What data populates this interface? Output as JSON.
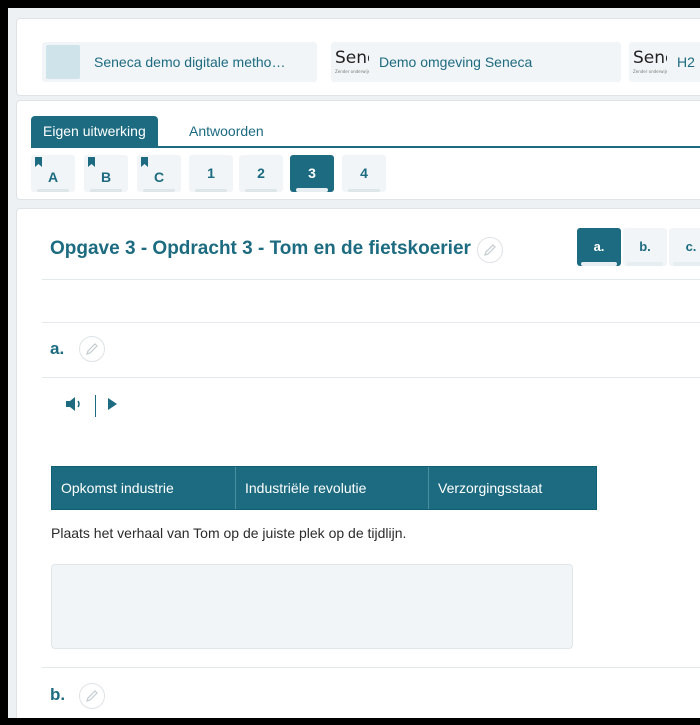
{
  "breadcrumbs": [
    {
      "label": "Seneca demo digitale metho…",
      "thumb": "plain"
    },
    {
      "label": "Demo omgeving Seneca",
      "thumb": "logo",
      "logo_text": "Sene"
    },
    {
      "label": "H2",
      "thumb": "logo",
      "logo_text": "Sene"
    }
  ],
  "mode_tabs": [
    {
      "label": "Eigen uitwerking",
      "active": true
    },
    {
      "label": "Antwoorden",
      "active": false
    }
  ],
  "question_tabs": [
    {
      "label": "A",
      "bookmark": true
    },
    {
      "label": "B",
      "bookmark": true
    },
    {
      "label": "C",
      "bookmark": true
    },
    {
      "label": "1"
    },
    {
      "label": "2"
    },
    {
      "label": "3",
      "active": true
    },
    {
      "label": "4"
    }
  ],
  "card": {
    "title": "Opgave 3 - Opdracht 3 - Tom en de fietskoerier",
    "sub_tabs": [
      {
        "label": "a.",
        "active": true
      },
      {
        "label": "b."
      },
      {
        "label": "c."
      }
    ]
  },
  "part_a": {
    "label": "a."
  },
  "part_b": {
    "label": "b."
  },
  "timeline": [
    "Opkomst industrie",
    "Industriële revolutie",
    "Verzorgingsstaat"
  ],
  "instruction": "Plaats het verhaal van Tom op de juiste plek op de tijdlijn.",
  "icons": {
    "speaker": "speaker-icon",
    "play": "play-icon",
    "pencil": "pencil-icon",
    "bookmark": "bookmark-icon"
  },
  "colors": {
    "accent": "#1c6b80",
    "panel": "#f2f5f7",
    "background": "#eef1f3"
  }
}
